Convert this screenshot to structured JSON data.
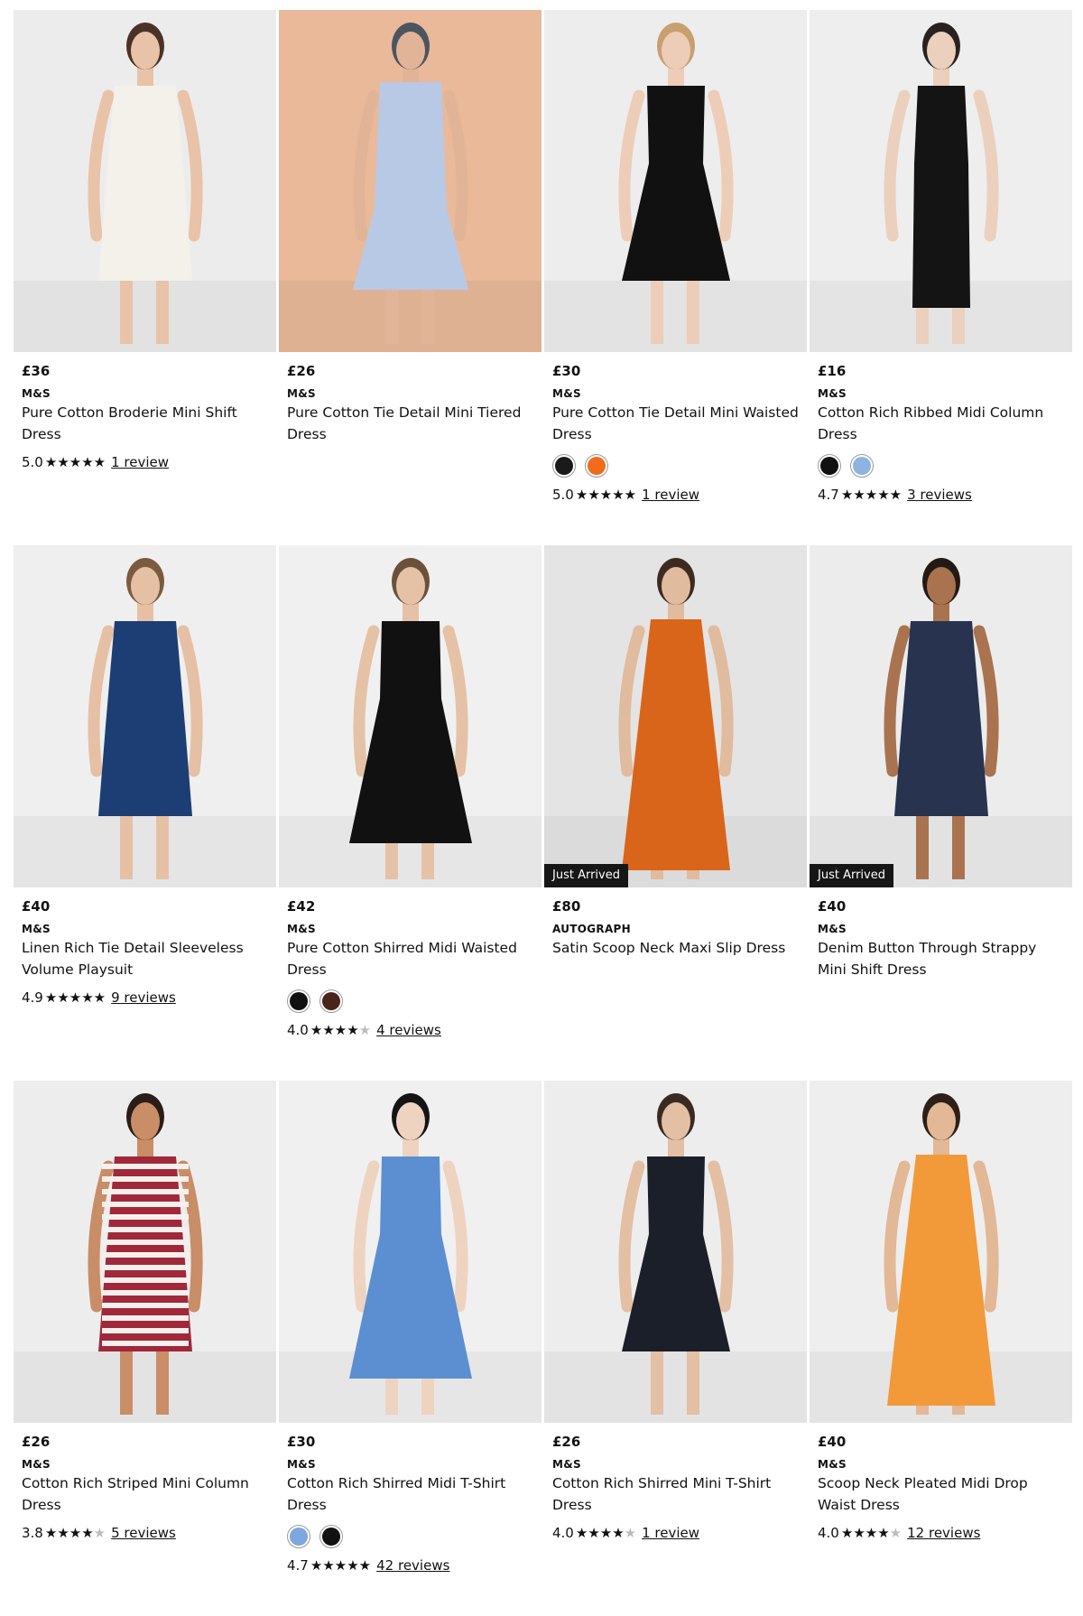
{
  "products": [
    {
      "price": "£36",
      "brand": "M&S",
      "title": "Pure Cotton Broderie Mini Shift Dress",
      "badge": "",
      "swatches": [],
      "rating": "5.0",
      "stars": 5,
      "reviews": "1 review",
      "bg": "#ececec",
      "dress": "#f3f1ea",
      "skin": "#e8c3a8",
      "hair": "#4a3326",
      "dress_shape": "shift"
    },
    {
      "price": "£26",
      "brand": "M&S",
      "title": "Pure Cotton Tie Detail Mini Tiered Dress",
      "badge": "",
      "swatches": [],
      "rating": "",
      "stars": 0,
      "reviews": "",
      "bg": "#e9b99a",
      "dress": "#b8c9e6",
      "skin": "#e2b497",
      "hair": "#4b5560",
      "dress_shape": "tiered"
    },
    {
      "price": "£30",
      "brand": "M&S",
      "title": "Pure Cotton Tie Detail Mini Waisted Dress",
      "badge": "",
      "swatches": [
        "#1a1a1a",
        "#f26b1d"
      ],
      "rating": "5.0",
      "stars": 5,
      "reviews": "1 review",
      "bg": "#ededed",
      "dress": "#111111",
      "skin": "#edcdb8",
      "hair": "#c8a070",
      "dress_shape": "waisted"
    },
    {
      "price": "£16",
      "brand": "M&S",
      "title": "Cotton Rich Ribbed Midi Column Dress",
      "badge": "",
      "swatches": [
        "#111111",
        "#8fb3e0"
      ],
      "rating": "4.7",
      "stars": 4.7,
      "reviews": "3 reviews",
      "bg": "#eeeeee",
      "dress": "#141414",
      "skin": "#ead0bd",
      "hair": "#2a2220",
      "dress_shape": "column"
    },
    {
      "price": "£40",
      "brand": "M&S",
      "title": "Linen Rich Tie Detail Sleeveless Volume Playsuit",
      "badge": "",
      "swatches": [],
      "rating": "4.9",
      "stars": 5,
      "reviews": "9 reviews",
      "bg": "#efefef",
      "dress": "#1d3e74",
      "skin": "#e6c0a4",
      "hair": "#7a5b40",
      "dress_shape": "shift"
    },
    {
      "price": "£42",
      "brand": "M&S",
      "title": "Pure Cotton Shirred Midi Waisted Dress",
      "badge": "",
      "swatches": [
        "#111111",
        "#4a2418"
      ],
      "rating": "4.0",
      "stars": 4,
      "reviews": "4 reviews",
      "bg": "#f0f0f0",
      "dress": "#111111",
      "skin": "#e5c2a6",
      "hair": "#6b5139",
      "dress_shape": "midi"
    },
    {
      "price": "£80",
      "brand": "AUTOGRAPH",
      "title": "Satin Scoop Neck Maxi Slip Dress",
      "badge": "Just Arrived",
      "swatches": [],
      "rating": "",
      "stars": 0,
      "reviews": "",
      "bg": "#e4e4e4",
      "dress": "#d9651a",
      "skin": "#e0bb9e",
      "hair": "#3d2a20",
      "dress_shape": "maxi"
    },
    {
      "price": "£40",
      "brand": "M&S",
      "title": "Denim Button Through Strappy Mini Shift Dress",
      "badge": "Just Arrived",
      "swatches": [],
      "rating": "",
      "stars": 0,
      "reviews": "",
      "bg": "#ececec",
      "dress": "#27334f",
      "skin": "#a9734f",
      "hair": "#231a15",
      "dress_shape": "shift"
    },
    {
      "price": "£26",
      "brand": "M&S",
      "title": "Cotton Rich Striped Mini Column Dress",
      "badge": "",
      "swatches": [],
      "rating": "3.8",
      "stars": 4,
      "reviews": "5 reviews",
      "bg": "#ededed",
      "dress": "#a0283a",
      "skin": "#c98d67",
      "hair": "#2a1d18",
      "dress_shape": "stripe"
    },
    {
      "price": "£30",
      "brand": "M&S",
      "title": "Cotton Rich Shirred Midi T-Shirt Dress",
      "badge": "",
      "swatches": [
        "#7ea6df",
        "#111111"
      ],
      "rating": "4.7",
      "stars": 4.7,
      "reviews": "42 reviews",
      "bg": "#f0f0f0",
      "dress": "#5b8fd1",
      "skin": "#eed3c0",
      "hair": "#141414",
      "dress_shape": "midi"
    },
    {
      "price": "£26",
      "brand": "M&S",
      "title": "Cotton Rich Shirred Mini T-Shirt Dress",
      "badge": "",
      "swatches": [],
      "rating": "4.0",
      "stars": 4,
      "reviews": "1 review",
      "bg": "#ededed",
      "dress": "#1b1f2a",
      "skin": "#e3bfa4",
      "hair": "#3a2a22",
      "dress_shape": "waisted"
    },
    {
      "price": "£40",
      "brand": "M&S",
      "title": "Scoop Neck Pleated Midi Drop Waist Dress",
      "badge": "",
      "swatches": [],
      "rating": "4.0",
      "stars": 4,
      "reviews": "12 reviews",
      "bg": "#eeeeee",
      "dress": "#f29a3a",
      "skin": "#e2b896",
      "hair": "#2e2018",
      "dress_shape": "maxi"
    }
  ]
}
